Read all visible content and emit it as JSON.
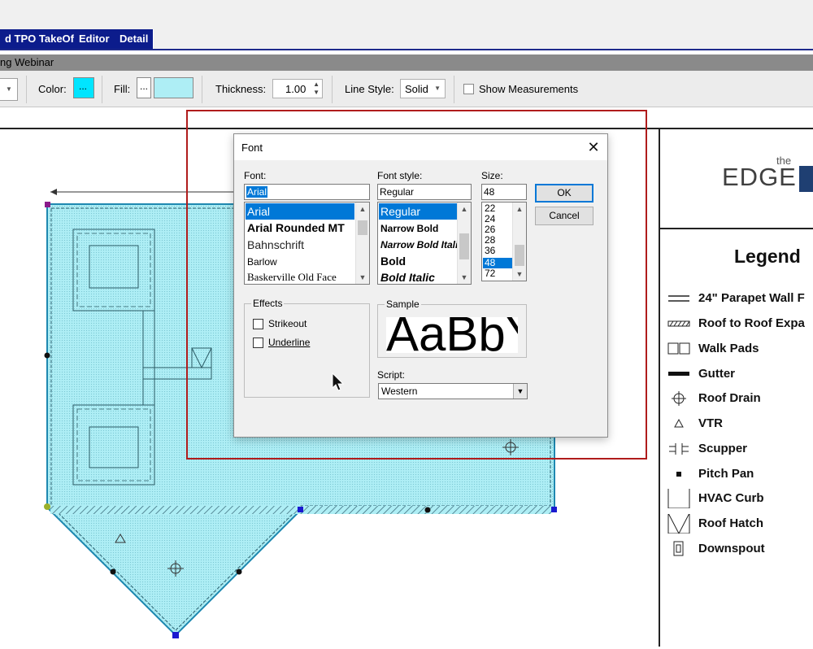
{
  "tabs": [
    {
      "label": "d TPO TakeOff"
    },
    {
      "label": "Editor"
    },
    {
      "label": "Detail"
    }
  ],
  "subbar": {
    "label": "ng Webinar"
  },
  "toolbar": {
    "color_label": "Color:",
    "color_button": "...",
    "color_value": "#00e5ff",
    "fill_label": "Fill:",
    "fill_button": "...",
    "fill_value": "#aeeef5",
    "thickness_label": "Thickness:",
    "thickness_value": "1.00",
    "line_style_label": "Line Style:",
    "line_style_value": "Solid",
    "show_measurements_label": "Show Measurements"
  },
  "font_dialog": {
    "title": "Font",
    "font_label": "Font:",
    "font_value": "Arial",
    "font_list": [
      "Arial",
      "Arial Rounded MT",
      "Bahnschrift",
      "Barlow",
      "Baskerville Old Face"
    ],
    "font_selected": "Arial",
    "style_label": "Font style:",
    "style_value": "Regular",
    "style_list": [
      "Regular",
      "Narrow Bold",
      "Narrow Bold Italic",
      "Bold",
      "Bold Italic"
    ],
    "style_selected": "Regular",
    "size_label": "Size:",
    "size_value": "48",
    "size_list": [
      "22",
      "24",
      "26",
      "28",
      "36",
      "48",
      "72"
    ],
    "size_selected": "48",
    "ok_label": "OK",
    "cancel_label": "Cancel",
    "effects_label": "Effects",
    "strikeout_label": "Strikeout",
    "underline_label": "Underline",
    "sample_label": "Sample",
    "sample_text": "AaBbYyZz",
    "script_label": "Script:",
    "script_value": "Western"
  },
  "logo": {
    "the": "the",
    "edge": "EDGE"
  },
  "legend": {
    "title": "Legend",
    "items": [
      {
        "label": "24\" Parapet Wall F",
        "icon": "parapet-wall-icon"
      },
      {
        "label": "Roof to Roof Expa",
        "icon": "expansion-joint-icon"
      },
      {
        "label": "Walk Pads",
        "icon": "walk-pads-icon"
      },
      {
        "label": "Gutter",
        "icon": "gutter-icon"
      },
      {
        "label": "Roof Drain",
        "icon": "roof-drain-icon"
      },
      {
        "label": "VTR",
        "icon": "vtr-icon"
      },
      {
        "label": "Scupper",
        "icon": "scupper-icon"
      },
      {
        "label": "Pitch Pan",
        "icon": "pitch-pan-icon"
      },
      {
        "label": "HVAC Curb",
        "icon": "hvac-curb-icon"
      },
      {
        "label": "Roof Hatch",
        "icon": "roof-hatch-icon"
      },
      {
        "label": "Downspout",
        "icon": "downspout-icon"
      }
    ]
  },
  "colors": {
    "tab_bg": "#0c1c8c",
    "roof_fill": "#aeeef5",
    "roof_stroke": "#1e88b0",
    "highlight": "#b01c1c",
    "selection": "#0078d7"
  }
}
